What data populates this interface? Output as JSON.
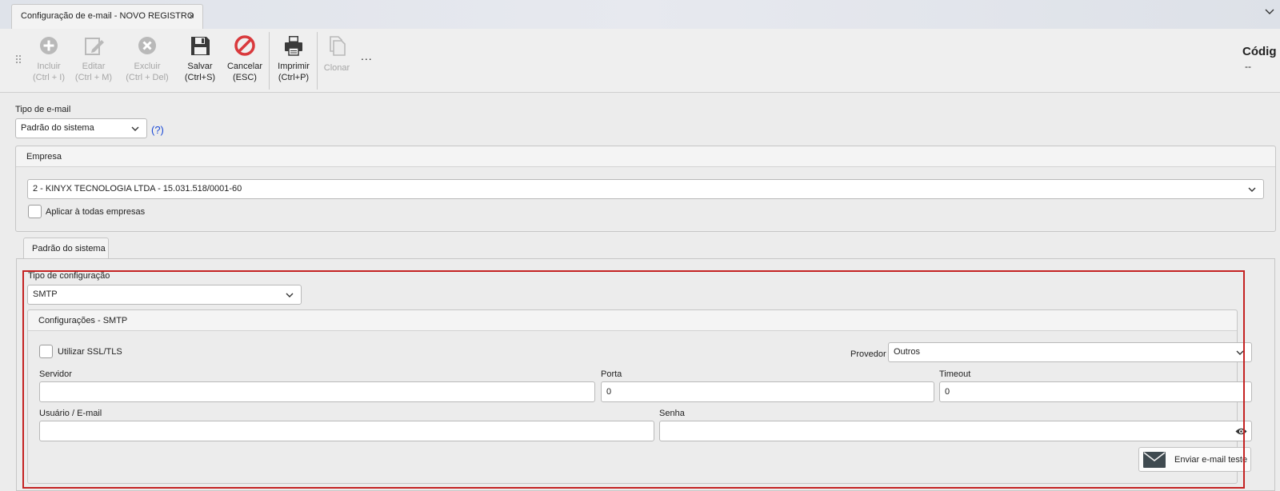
{
  "window": {
    "tab_title": "Configuração de e-mail - NOVO REGISTRO",
    "close_glyph": "×"
  },
  "toolbar": {
    "buttons": [
      {
        "name": "incluir",
        "line1": "Incluir",
        "line2": "(Ctrl + I)",
        "enabled": false,
        "icon": "plus-circle-icon"
      },
      {
        "name": "editar",
        "line1": "Editar",
        "line2": "(Ctrl + M)",
        "enabled": false,
        "icon": "edit-icon"
      },
      {
        "name": "excluir",
        "line1": "Excluir",
        "line2": "(Ctrl + Del)",
        "enabled": false,
        "icon": "x-circle-icon"
      },
      {
        "name": "salvar",
        "line1": "Salvar",
        "line2": "(Ctrl+S)",
        "enabled": true,
        "icon": "save-icon"
      },
      {
        "name": "cancelar",
        "line1": "Cancelar",
        "line2": "(ESC)",
        "enabled": true,
        "icon": "cancel-icon"
      },
      {
        "name": "imprimir",
        "line1": "Imprimir",
        "line2": "(Ctrl+P)",
        "enabled": true,
        "icon": "printer-icon"
      },
      {
        "name": "clonar",
        "line1": "Clonar",
        "line2": "",
        "enabled": false,
        "icon": "copy-icon"
      }
    ],
    "more": "...",
    "codigo_label": "Códig",
    "codigo_value": "--"
  },
  "form": {
    "tipo_email_label": "Tipo de e-mail",
    "tipo_email_value": "Padrão do sistema",
    "help": "(?)",
    "empresa": {
      "title": "Empresa",
      "value": "2 - KINYX TECNOLOGIA LTDA - 15.031.518/0001-60",
      "apply_all_label": "Aplicar à todas empresas",
      "apply_all_checked": false
    },
    "tab_label": "Padrão do sistema",
    "tipo_config_label": "Tipo de configuração",
    "tipo_config_value": "SMTP",
    "smtp": {
      "title": "Configurações - SMTP",
      "ssl_label": "Utilizar SSL/TLS",
      "ssl_checked": false,
      "provedor_label": "Provedor",
      "provedor_value": "Outros",
      "servidor_label": "Servidor",
      "servidor_value": "",
      "porta_label": "Porta",
      "porta_value": "0",
      "timeout_label": "Timeout",
      "timeout_value": "0",
      "usuario_label": "Usuário / E-mail",
      "usuario_value": "",
      "senha_label": "Senha",
      "senha_value": "",
      "send_test_label": "Enviar e-mail teste"
    }
  },
  "colors": {
    "highlight_border": "#c42323",
    "link": "#1a49d6",
    "cancel_icon": "#d9393c"
  }
}
